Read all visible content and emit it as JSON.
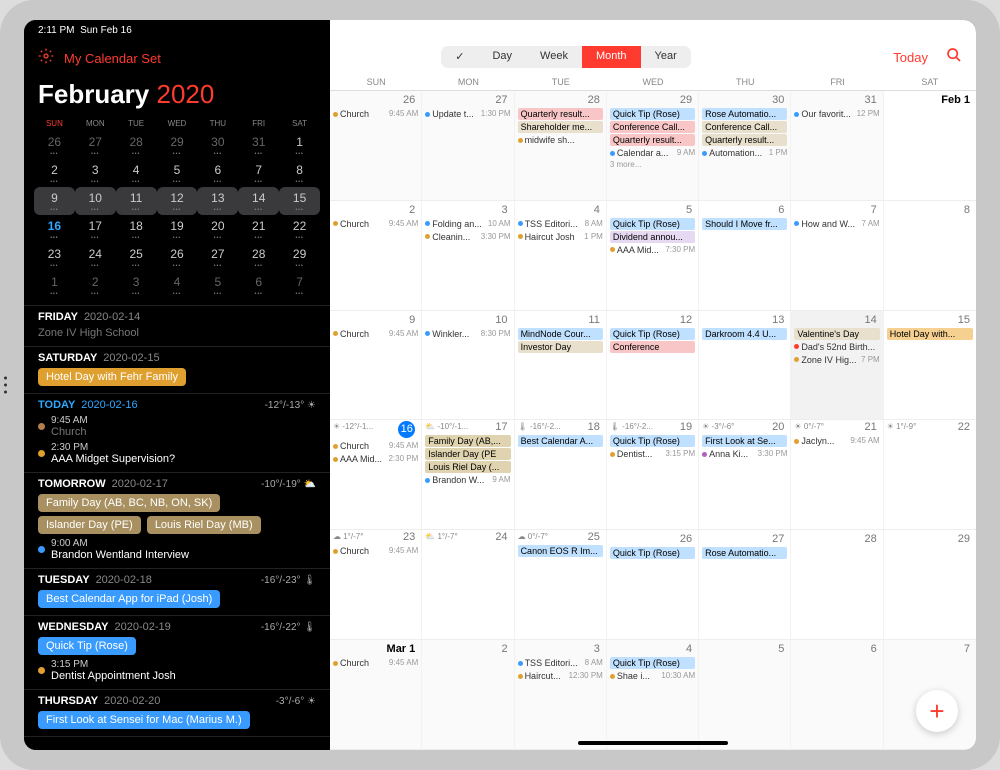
{
  "status": {
    "time": "2:11 PM",
    "date": "Sun Feb 16",
    "wifi": "wifi",
    "battery": "battery"
  },
  "sidebar": {
    "set_name": "My Calendar Set",
    "month": "February",
    "year": "2020",
    "dows": [
      "SUN",
      "MON",
      "TUE",
      "WED",
      "THU",
      "FRI",
      "SAT"
    ],
    "mini_rows": [
      [
        {
          "n": "26",
          "dim": true
        },
        {
          "n": "27",
          "dim": true
        },
        {
          "n": "28",
          "dim": true
        },
        {
          "n": "29",
          "dim": true
        },
        {
          "n": "30",
          "dim": true
        },
        {
          "n": "31",
          "dim": true
        },
        {
          "n": "1"
        }
      ],
      [
        {
          "n": "2"
        },
        {
          "n": "3"
        },
        {
          "n": "4"
        },
        {
          "n": "5"
        },
        {
          "n": "6"
        },
        {
          "n": "7"
        },
        {
          "n": "8"
        }
      ],
      [
        {
          "n": "9",
          "sel": true
        },
        {
          "n": "10",
          "sel": true
        },
        {
          "n": "11",
          "sel": true
        },
        {
          "n": "12",
          "sel": true
        },
        {
          "n": "13",
          "sel": true
        },
        {
          "n": "14",
          "sel": true,
          "circ": true
        },
        {
          "n": "15",
          "sel": true
        }
      ],
      [
        {
          "n": "16",
          "today": true
        },
        {
          "n": "17"
        },
        {
          "n": "18"
        },
        {
          "n": "19"
        },
        {
          "n": "20"
        },
        {
          "n": "21"
        },
        {
          "n": "22"
        }
      ],
      [
        {
          "n": "23"
        },
        {
          "n": "24"
        },
        {
          "n": "25"
        },
        {
          "n": "26"
        },
        {
          "n": "27"
        },
        {
          "n": "28"
        },
        {
          "n": "29"
        }
      ],
      [
        {
          "n": "1",
          "dim": true
        },
        {
          "n": "2",
          "dim": true
        },
        {
          "n": "3",
          "dim": true
        },
        {
          "n": "4",
          "dim": true
        },
        {
          "n": "5",
          "dim": true
        },
        {
          "n": "6",
          "dim": true
        },
        {
          "n": "7",
          "dim": true
        }
      ]
    ],
    "agenda": [
      {
        "day": "FRIDAY",
        "date": "2020-02-14",
        "items": [
          {
            "title": "Zone IV High School",
            "dim": true
          }
        ]
      },
      {
        "day": "SATURDAY",
        "date": "2020-02-15",
        "chips": [
          {
            "t": "Hotel Day with Fehr Family",
            "c": "#e0a030"
          }
        ]
      },
      {
        "day": "TODAY",
        "date": "2020-02-16",
        "today": true,
        "temp": "-12°/-13°",
        "icon": "☀",
        "items": [
          {
            "time": "9:45 AM",
            "title": "Church",
            "dot": "#b08050",
            "dim": true
          },
          {
            "time": "2:30 PM",
            "title": "AAA Midget Supervision?",
            "dot": "#e0a030"
          }
        ]
      },
      {
        "day": "TOMORROW",
        "date": "2020-02-17",
        "temp": "-10°/-19°",
        "icon": "⛅",
        "chips": [
          {
            "t": "Family Day (AB, BC, NB, ON, SK)",
            "c": "#a89060"
          },
          {
            "t": "Islander Day (PE)",
            "c": "#a89060"
          },
          {
            "t": "Louis Riel Day (MB)",
            "c": "#a89060"
          }
        ],
        "items": [
          {
            "time": "9:00 AM",
            "title": "Brandon Wentland Interview",
            "dot": "#3a9bff"
          }
        ]
      },
      {
        "day": "TUESDAY",
        "date": "2020-02-18",
        "temp": "-16°/-23°",
        "icon": "🌡",
        "chips": [
          {
            "t": "Best Calendar App for iPad (Josh)",
            "c": "#3a9bff"
          }
        ]
      },
      {
        "day": "WEDNESDAY",
        "date": "2020-02-19",
        "temp": "-16°/-22°",
        "icon": "🌡",
        "chips": [
          {
            "t": "Quick Tip (Rose)",
            "c": "#3a9bff"
          }
        ],
        "items": [
          {
            "time": "3:15 PM",
            "title": "Dentist Appointment Josh",
            "dot": "#e0a030"
          }
        ]
      },
      {
        "day": "THURSDAY",
        "date": "2020-02-20",
        "temp": "-3°/-6°",
        "icon": "☀",
        "chips": [
          {
            "t": "First Look at Sensei for Mac (Marius M.)",
            "c": "#3a9bff"
          }
        ]
      }
    ]
  },
  "main": {
    "tabs": [
      "✓",
      "Day",
      "Week",
      "Month",
      "Year"
    ],
    "active_tab": 3,
    "today_label": "Today",
    "dows": [
      "SUN",
      "MON",
      "TUE",
      "WED",
      "THU",
      "FRI",
      "SAT"
    ],
    "weeks": [
      [
        {
          "n": "26",
          "other": true,
          "events": [
            {
              "d": "#e0a030",
              "txt": "Church",
              "t": "9:45 AM"
            }
          ]
        },
        {
          "n": "27",
          "other": true,
          "events": [
            {
              "d": "#3a9bff",
              "txt": "Update t...",
              "t": "1:30 PM"
            }
          ]
        },
        {
          "n": "28",
          "other": true,
          "bars": [
            {
              "txt": "Quarterly result...",
              "c": "#f8c6c6"
            },
            {
              "txt": "Shareholder me...",
              "c": "#e8e0cc"
            }
          ],
          "events": [
            {
              "d": "#e0a030",
              "txt": "midwife sh...",
              "t": ""
            }
          ]
        },
        {
          "n": "29",
          "other": true,
          "bars": [
            {
              "txt": "Quick Tip (Rose)",
              "c": "#bfe0ff"
            },
            {
              "txt": "Conference Call...",
              "c": "#f8c6c6"
            },
            {
              "txt": "Quarterly result...",
              "c": "#f8c6c6"
            }
          ],
          "events": [
            {
              "d": "#3a9bff",
              "txt": "Calendar a...",
              "t": "9 AM"
            }
          ],
          "more": "3 more..."
        },
        {
          "n": "30",
          "other": true,
          "bars": [
            {
              "txt": "Rose Automatio...",
              "c": "#bfe0ff"
            },
            {
              "txt": "Conference Call...",
              "c": "#e8e0cc"
            },
            {
              "txt": "Quarterly result...",
              "c": "#e8e0cc"
            }
          ],
          "events": [
            {
              "d": "#3a9bff",
              "txt": "Automation...",
              "t": "1 PM"
            }
          ]
        },
        {
          "n": "31",
          "other": true,
          "events": [
            {
              "d": "#3a9bff",
              "txt": "Our favorit...",
              "t": "12 PM"
            }
          ]
        },
        {
          "n": "Feb 1",
          "bold": true
        }
      ],
      [
        {
          "n": "2",
          "events": [
            {
              "d": "#e0a030",
              "txt": "Church",
              "t": "9:45 AM"
            }
          ]
        },
        {
          "n": "3",
          "events": [
            {
              "d": "#3a9bff",
              "txt": "Folding an...",
              "t": "10 AM"
            },
            {
              "d": "#e0a030",
              "txt": "Cleanin...",
              "t": "3:30 PM"
            }
          ]
        },
        {
          "n": "4",
          "events": [
            {
              "d": "#3a9bff",
              "txt": "TSS Editori...",
              "t": "8 AM"
            },
            {
              "d": "#e0a030",
              "txt": "Haircut Josh",
              "t": "1 PM"
            }
          ]
        },
        {
          "n": "5",
          "bars": [
            {
              "txt": "Quick Tip (Rose)",
              "c": "#bfe0ff"
            },
            {
              "txt": "Dividend annou...",
              "c": "#e6d9f2"
            }
          ],
          "events": [
            {
              "d": "#e0a030",
              "txt": "AAA Mid...",
              "t": "7:30 PM"
            }
          ]
        },
        {
          "n": "6",
          "bars": [
            {
              "txt": "Should I Move fr...",
              "c": "#bfe0ff"
            }
          ]
        },
        {
          "n": "7",
          "events": [
            {
              "d": "#3a9bff",
              "txt": "How and W...",
              "t": "7 AM"
            }
          ]
        },
        {
          "n": "8"
        }
      ],
      [
        {
          "n": "9",
          "events": [
            {
              "d": "#e0a030",
              "txt": "Church",
              "t": "9:45 AM"
            }
          ]
        },
        {
          "n": "10",
          "events": [
            {
              "d": "#3a9bff",
              "txt": "Winkler...",
              "t": "8:30 PM"
            }
          ]
        },
        {
          "n": "11",
          "bars": [
            {
              "txt": "MindNode Cour...",
              "c": "#bfe0ff"
            },
            {
              "txt": "Investor Day",
              "c": "#e8e0cc"
            }
          ]
        },
        {
          "n": "12",
          "bars": [
            {
              "txt": "Quick Tip (Rose)",
              "c": "#bfe0ff"
            },
            {
              "txt": "Conference",
              "c": "#f8c6c6"
            }
          ]
        },
        {
          "n": "13",
          "bars": [
            {
              "txt": "Darkroom 4.4 U...",
              "c": "#bfe0ff"
            }
          ]
        },
        {
          "n": "14",
          "sel": true,
          "bars": [
            {
              "txt": "Valentine's Day",
              "c": "#e8e0cc"
            }
          ],
          "events": [
            {
              "d": "#ff3b30",
              "txt": "Dad's 52nd Birth...",
              "t": ""
            },
            {
              "d": "#e0a030",
              "txt": "Zone IV Hig...",
              "t": "7 PM"
            }
          ]
        },
        {
          "n": "15",
          "bars": [
            {
              "txt": "Hotel Day with...",
              "c": "#f5d090"
            }
          ]
        }
      ],
      [
        {
          "n": "16",
          "today": true,
          "weather": "☀ -12°/-1...",
          "events": [
            {
              "d": "#e0a030",
              "txt": "Church",
              "t": "9:45 AM"
            },
            {
              "d": "#e0a030",
              "txt": "AAA Mid...",
              "t": "2:30 PM"
            }
          ]
        },
        {
          "n": "17",
          "weather": "⛅ -10°/-1...",
          "bars": [
            {
              "txt": "Family Day (AB,...",
              "c": "#e0d4b0"
            },
            {
              "txt": "Islander Day (PE",
              "c": "#e0d4b0"
            },
            {
              "txt": "Louis Riel Day (...",
              "c": "#e0d4b0"
            }
          ],
          "events": [
            {
              "d": "#3a9bff",
              "txt": "Brandon W...",
              "t": "9 AM"
            }
          ]
        },
        {
          "n": "18",
          "weather": "🌡 -16°/-2...",
          "bars": [
            {
              "txt": "Best Calendar A...",
              "c": "#bfe0ff"
            }
          ]
        },
        {
          "n": "19",
          "weather": "🌡 -16°/-2...",
          "bars": [
            {
              "txt": "Quick Tip (Rose)",
              "c": "#bfe0ff"
            }
          ],
          "events": [
            {
              "d": "#e0a030",
              "txt": "Dentist...",
              "t": "3:15 PM"
            }
          ]
        },
        {
          "n": "20",
          "weather": "☀ -3°/-6°",
          "bars": [
            {
              "txt": "First Look at Se...",
              "c": "#bfe0ff"
            }
          ],
          "events": [
            {
              "d": "#b060c0",
              "txt": "Anna Ki...",
              "t": "3:30 PM"
            }
          ]
        },
        {
          "n": "21",
          "weather": "☀ 0°/-7°",
          "events": [
            {
              "d": "#e0a030",
              "txt": "Jaclyn...",
              "t": "9:45 AM"
            }
          ]
        },
        {
          "n": "22",
          "weather": "☀ 1°/-9°"
        }
      ],
      [
        {
          "n": "23",
          "weather": "☁ 1°/-7°",
          "events": [
            {
              "d": "#e0a030",
              "txt": "Church",
              "t": "9:45 AM"
            }
          ]
        },
        {
          "n": "24",
          "weather": "⛅ 1°/-7°"
        },
        {
          "n": "25",
          "weather": "☁ 0°/-7°",
          "bars": [
            {
              "txt": "Canon EOS R Im...",
              "c": "#bfe0ff"
            }
          ]
        },
        {
          "n": "26",
          "bars": [
            {
              "txt": "Quick Tip (Rose)",
              "c": "#bfe0ff"
            }
          ]
        },
        {
          "n": "27",
          "bars": [
            {
              "txt": "Rose Automatio...",
              "c": "#bfe0ff"
            }
          ]
        },
        {
          "n": "28"
        },
        {
          "n": "29"
        }
      ],
      [
        {
          "n": "Mar 1",
          "bold": true,
          "other": true,
          "events": [
            {
              "d": "#e0a030",
              "txt": "Church",
              "t": "9:45 AM"
            }
          ]
        },
        {
          "n": "2",
          "other": true
        },
        {
          "n": "3",
          "other": true,
          "events": [
            {
              "d": "#3a9bff",
              "txt": "TSS Editori...",
              "t": "8 AM"
            },
            {
              "d": "#e0a030",
              "txt": "Haircut...",
              "t": "12:30 PM"
            }
          ]
        },
        {
          "n": "4",
          "other": true,
          "bars": [
            {
              "txt": "Quick Tip (Rose)",
              "c": "#bfe0ff"
            }
          ],
          "events": [
            {
              "d": "#e0a030",
              "txt": "Shae i...",
              "t": "10:30 AM"
            }
          ]
        },
        {
          "n": "5",
          "other": true
        },
        {
          "n": "6",
          "other": true
        },
        {
          "n": "7",
          "other": true
        }
      ]
    ]
  }
}
